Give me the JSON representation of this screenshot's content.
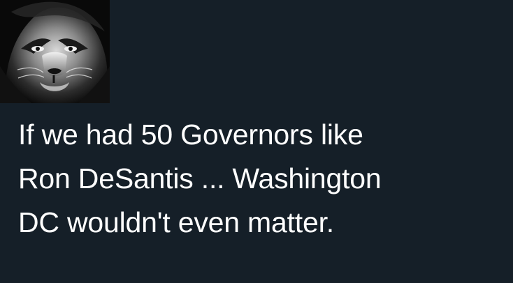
{
  "post": {
    "avatar_icon": "lion-face-icon",
    "lines": [
      "If we had 50 Governors like",
      "Ron DeSantis ... Washington",
      "DC wouldn't even matter."
    ]
  },
  "colors": {
    "background": "#151f28",
    "text": "#ffffff"
  }
}
